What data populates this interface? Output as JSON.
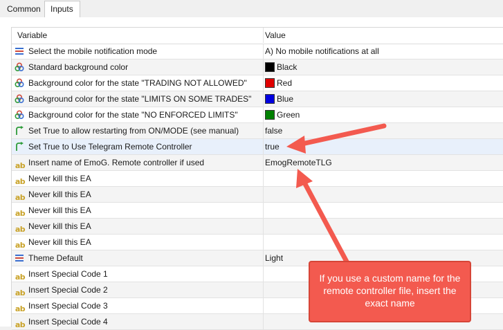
{
  "tabs": [
    {
      "label": "Common"
    },
    {
      "label": "Inputs"
    }
  ],
  "table": {
    "headers": {
      "variable": "Variable",
      "value": "Value"
    },
    "rows": [
      {
        "icon": "enum-icon",
        "variable": "Select the mobile notification mode",
        "value": "A) No mobile notifications at all"
      },
      {
        "icon": "color-icon",
        "variable": "Standard background color",
        "value": "Black",
        "swatch": "#000000"
      },
      {
        "icon": "color-icon",
        "variable": "Background color for the state \"TRADING NOT ALLOWED\"",
        "value": "Red",
        "swatch": "#e00000"
      },
      {
        "icon": "color-icon",
        "variable": "Background color for the state \"LIMITS ON SOME TRADES\"",
        "value": "Blue",
        "swatch": "#0000e0"
      },
      {
        "icon": "color-icon",
        "variable": "Background color for the state \"NO ENFORCED LIMITS\"",
        "value": "Green",
        "swatch": "#008000"
      },
      {
        "icon": "bool-icon",
        "variable": "Set True to allow restarting from ON/MODE (see manual)",
        "value": "false"
      },
      {
        "icon": "bool-icon",
        "variable": "Set True to Use Telegram Remote Controller",
        "value": "true"
      },
      {
        "icon": "string-icon",
        "variable": "Insert name of EmoG. Remote controller if used",
        "value": "EmogRemoteTLG"
      },
      {
        "icon": "string-icon",
        "variable": "Never kill this EA",
        "value": ""
      },
      {
        "icon": "string-icon",
        "variable": "Never kill this EA",
        "value": ""
      },
      {
        "icon": "string-icon",
        "variable": "Never kill this EA",
        "value": ""
      },
      {
        "icon": "string-icon",
        "variable": "Never kill this EA",
        "value": ""
      },
      {
        "icon": "string-icon",
        "variable": "Never kill this EA",
        "value": ""
      },
      {
        "icon": "enum-icon",
        "variable": "Theme Default",
        "value": "Light"
      },
      {
        "icon": "string-icon",
        "variable": "Insert Special Code 1",
        "value": ""
      },
      {
        "icon": "string-icon",
        "variable": "Insert Special Code 2",
        "value": ""
      },
      {
        "icon": "string-icon",
        "variable": "Insert Special Code 3",
        "value": ""
      },
      {
        "icon": "string-icon",
        "variable": "Insert Special Code 4",
        "value": ""
      }
    ]
  },
  "icon_glyphs": {
    "string": "ab"
  },
  "annotation": {
    "text": "If you use a custom name for the remote controller file, insert the exact name",
    "color": "#f35a4f"
  }
}
